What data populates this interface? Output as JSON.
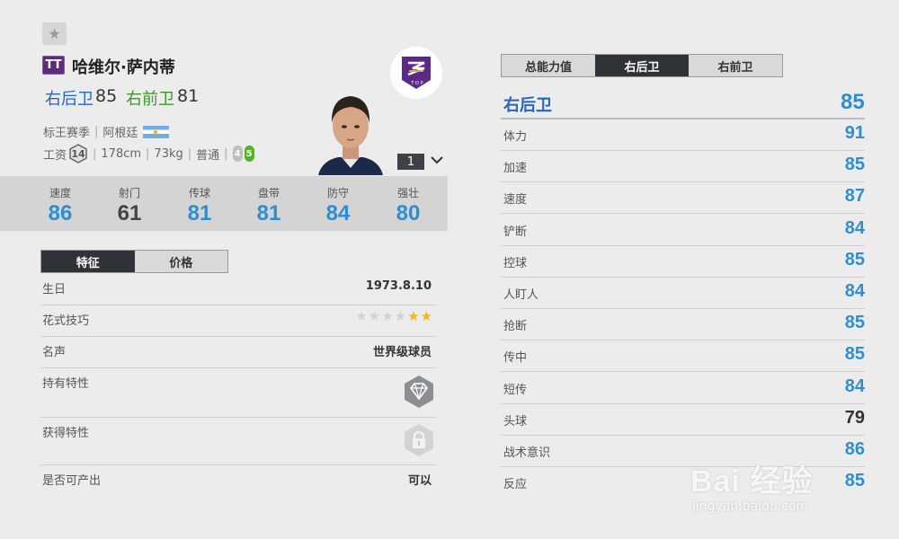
{
  "player": {
    "season_badge": "TT",
    "name": "哈维尔·萨内蒂",
    "positions": [
      {
        "label": "右后卫",
        "value": "85"
      },
      {
        "label": "右前卫",
        "value": "81"
      }
    ],
    "season": "标王赛季",
    "nationality": "阿根廷",
    "wage_label": "工资",
    "wage": "14",
    "height": "178cm",
    "weight": "73kg",
    "body_type": "普通",
    "weak_foot": "4",
    "strong_foot": "5",
    "level": "1",
    "club_badge_text": "T O P"
  },
  "stats": [
    {
      "label": "速度",
      "value": "86",
      "color": "#2e8ed0"
    },
    {
      "label": "射门",
      "value": "61",
      "color": "#444444"
    },
    {
      "label": "传球",
      "value": "81",
      "color": "#2e8ed0"
    },
    {
      "label": "盘带",
      "value": "81",
      "color": "#2e8ed0"
    },
    {
      "label": "防守",
      "value": "84",
      "color": "#2e8ed0"
    },
    {
      "label": "强壮",
      "value": "80",
      "color": "#2e8ed0"
    }
  ],
  "left_tabs": [
    {
      "label": "特征",
      "active": true
    },
    {
      "label": "价格",
      "active": false
    }
  ],
  "traits": {
    "birthday_label": "生日",
    "birthday": "1973.8.10",
    "skill_label": "花式技巧",
    "skill_stars": 2,
    "skill_max": 6,
    "reputation_label": "名声",
    "reputation": "世界级球员",
    "owned_traits_label": "持有特性",
    "acquired_traits_label": "获得特性",
    "producible_label": "是否可产出",
    "producible": "可以"
  },
  "right_tabs": [
    {
      "label": "总能力值",
      "active": false
    },
    {
      "label": "右后卫",
      "active": true
    },
    {
      "label": "右前卫",
      "active": false
    }
  ],
  "position_detail": {
    "title": "右后卫",
    "value": "85",
    "rows": [
      {
        "label": "体力",
        "value": "91",
        "color": "#2e8ed0"
      },
      {
        "label": "加速",
        "value": "85",
        "color": "#2e8ed0"
      },
      {
        "label": "速度",
        "value": "87",
        "color": "#2e8ed0"
      },
      {
        "label": "铲断",
        "value": "84",
        "color": "#2e8ed0"
      },
      {
        "label": "控球",
        "value": "85",
        "color": "#2e8ed0"
      },
      {
        "label": "人盯人",
        "value": "84",
        "color": "#2e8ed0"
      },
      {
        "label": "抢断",
        "value": "85",
        "color": "#2e8ed0"
      },
      {
        "label": "传中",
        "value": "85",
        "color": "#2e8ed0"
      },
      {
        "label": "短传",
        "value": "84",
        "color": "#2e8ed0"
      },
      {
        "label": "头球",
        "value": "79",
        "color": "#333333"
      },
      {
        "label": "战术意识",
        "value": "86",
        "color": "#2e8ed0"
      },
      {
        "label": "反应",
        "value": "85",
        "color": "#2e8ed0"
      }
    ]
  },
  "watermark": {
    "main": "Bai 经验",
    "sub": "jingyan.baidu.com"
  }
}
